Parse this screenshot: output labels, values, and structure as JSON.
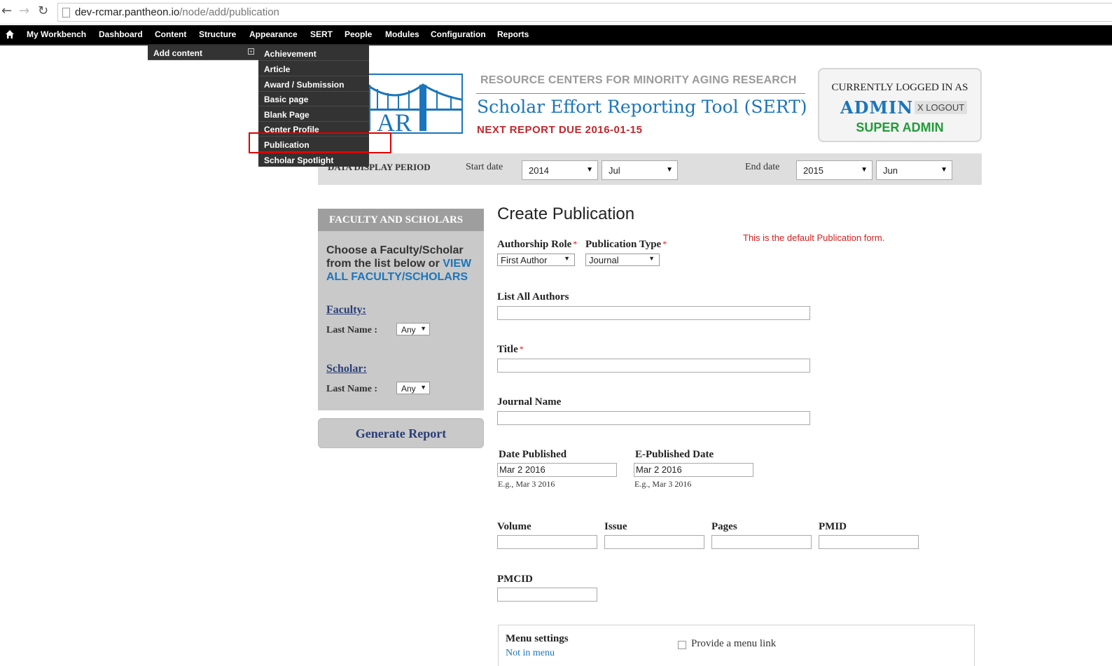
{
  "browser": {
    "url_host": "dev-rcmar.pantheon.io",
    "url_path": "/node/add/publication"
  },
  "toolbar": {
    "items": [
      "My Workbench",
      "Dashboard",
      "Content",
      "Structure",
      "Appearance",
      "SERT",
      "People",
      "Modules",
      "Configuration",
      "Reports"
    ]
  },
  "content_menu": {
    "add_content": "Add content",
    "types": [
      "Achievement",
      "Article",
      "Award / Submission",
      "Basic page",
      "Blank Page",
      "Center Profile",
      "Publication",
      "Scholar Spotlight"
    ],
    "highlighted": "Publication"
  },
  "header": {
    "logo_text": "RC  AR",
    "org": "RESOURCE CENTERS FOR MINORITY AGING RESEARCH",
    "title": "Scholar Effort Reporting Tool (SERT)",
    "next_report": "NEXT REPORT DUE 2016-01-15"
  },
  "login": {
    "label": "CURRENTLY LOGGED IN AS",
    "user": "ADMIN",
    "logout": "X LOGOUT",
    "role": "SUPER ADMIN"
  },
  "period": {
    "label": "DATA DISPLAY PERIOD",
    "start_label": "Start date",
    "start_year": "2014",
    "start_month": "Jul",
    "end_label": "End date",
    "end_year": "2015",
    "end_month": "Jun"
  },
  "sidebar": {
    "heading": "FACULTY AND SCHOLARS",
    "intro": "Choose a Faculty/Scholar from the list below or ",
    "view_all": "VIEW ALL FACULTY/SCHOLARS",
    "faculty_heading": "Faculty:",
    "faculty_lastname_label": "Last Name :",
    "faculty_lastname_value": "Any",
    "scholar_heading": "Scholar:",
    "scholar_lastname_label": "Last Name :",
    "scholar_lastname_value": "Any",
    "generate": "Generate Report"
  },
  "form": {
    "title": "Create Publication",
    "default_note": "This is the default Publication form.",
    "authorship_role_label": "Authorship Role",
    "authorship_role_value": "First Author",
    "publication_type_label": "Publication Type",
    "publication_type_value": "Journal",
    "required_mark": "*",
    "authors_label": "List All Authors",
    "title_label": "Title",
    "journal_label": "Journal Name",
    "date_published_label": "Date Published",
    "date_published_value": "Mar 2 2016",
    "date_published_hint": "E.g., Mar 3 2016",
    "epub_label": "E-Published Date",
    "epub_value": "Mar 2 2016",
    "epub_hint": "E.g., Mar 3 2016",
    "volume_label": "Volume",
    "issue_label": "Issue",
    "pages_label": "Pages",
    "pmid_label": "PMID",
    "pmcid_label": "PMCID",
    "menu_settings_label": "Menu settings",
    "menu_settings_value": "Not in menu",
    "menu_link_label": "Provide a menu link"
  },
  "colors": {
    "brand_blue": "#1b75bb",
    "alert_red": "#c1272d",
    "role_green": "#239b3a",
    "toolbar_bg": "#000000"
  }
}
